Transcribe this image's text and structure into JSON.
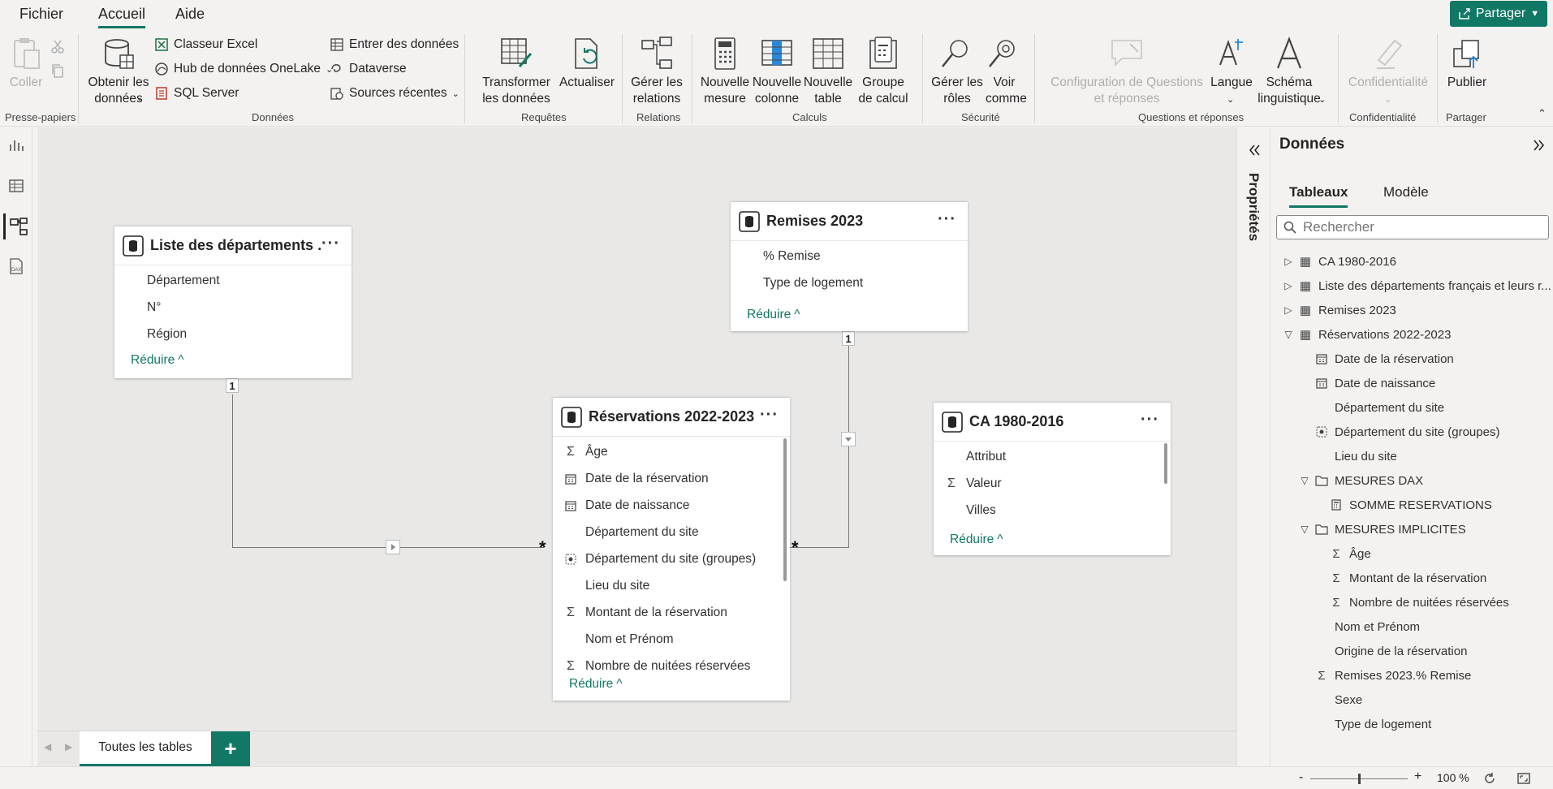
{
  "menu": {
    "file": "Fichier",
    "home": "Accueil",
    "help": "Aide",
    "share": "Partager"
  },
  "ribbon": {
    "clipboard": {
      "paste": "Coller",
      "group": "Presse-papiers"
    },
    "data": {
      "get_data": "Obtenir les données",
      "excel": "Classeur Excel",
      "onelake": "Hub de données OneLake",
      "sql": "SQL Server",
      "enter": "Entrer des données",
      "dataverse": "Dataverse",
      "recent": "Sources récentes",
      "group": "Données"
    },
    "queries": {
      "transform": "Transformer les données",
      "refresh": "Actualiser",
      "group": "Requêtes"
    },
    "relations": {
      "manage": "Gérer les relations",
      "group": "Relations"
    },
    "calcs": {
      "new_measure": "Nouvelle mesure",
      "new_column": "Nouvelle colonne",
      "new_table": "Nouvelle table",
      "calc_group": "Groupe de calcul",
      "group": "Calculs"
    },
    "security": {
      "manage_roles": "Gérer les rôles",
      "view_as": "Voir comme",
      "group": "Sécurité"
    },
    "qa": {
      "config": "Configuration de Questions et réponses",
      "language": "Langue",
      "schema": "Schéma linguistique",
      "group": "Questions et réponses"
    },
    "sensitivity": {
      "label": "Confidentialité",
      "group": "Confidentialité"
    },
    "share": {
      "publish": "Publier",
      "group": "Partager"
    }
  },
  "canvas": {
    "tables": {
      "departements": {
        "title": "Liste des départements ...",
        "fields": [
          "Département",
          "N°",
          "Région"
        ],
        "reduce": "Réduire"
      },
      "remises": {
        "title": "Remises 2023",
        "fields": [
          "% Remise",
          "Type de logement"
        ],
        "reduce": "Réduire"
      },
      "reservations": {
        "title": "Réservations 2022-2023",
        "fields": [
          "Âge",
          "Date de la réservation",
          "Date de naissance",
          "Département du site",
          "Département du site (groupes)",
          "Lieu du site",
          "Montant de la réservation",
          "Nom et Prénom",
          "Nombre de nuitées réservées"
        ],
        "reduce": "Réduire"
      },
      "ca": {
        "title": "CA 1980-2016",
        "fields": [
          "Attribut",
          "Valeur",
          "Villes"
        ],
        "reduce": "Réduire"
      }
    },
    "rel_one": "1",
    "rel_many": "*"
  },
  "tabs": {
    "all_tables": "Toutes les tables",
    "add": "+"
  },
  "props_label": "Propriétés",
  "panel": {
    "title": "Données",
    "tab_tables": "Tableaux",
    "tab_model": "Modèle",
    "search_placeholder": "Rechercher",
    "tree": [
      "CA 1980-2016",
      "Liste des départements français et leurs r...",
      "Remises 2023",
      "Réservations 2022-2023",
      "Date de la réservation",
      "Date de naissance",
      "Département du site",
      "Département du site (groupes)",
      "Lieu du site",
      "MESURES DAX",
      "SOMME RESERVATIONS",
      "MESURES IMPLICITES",
      "Âge",
      "Montant de la réservation",
      "Nombre de nuitées réservées",
      "Nom et Prénom",
      "Origine de la réservation",
      "Remises 2023.% Remise",
      "Sexe",
      "Type de logement"
    ]
  },
  "status": {
    "minus": "-",
    "plus": "+",
    "zoom": "100 %",
    "zoom_level": 100
  },
  "colors": {
    "accent": "#117865"
  }
}
